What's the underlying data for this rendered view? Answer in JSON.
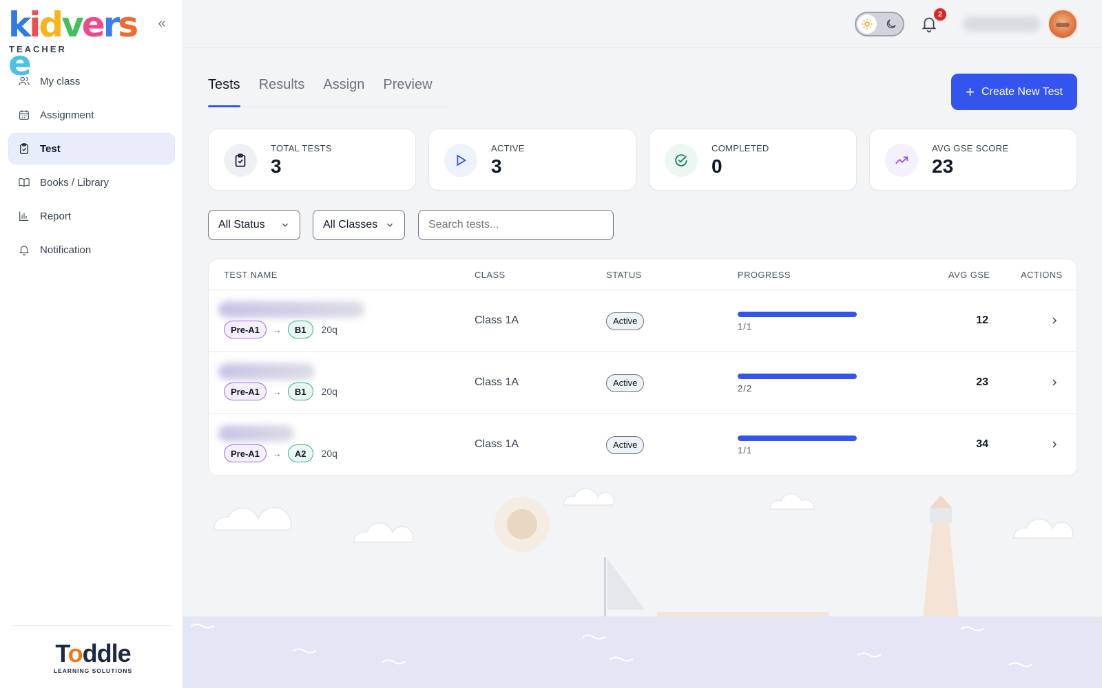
{
  "app": {
    "logo_letters": [
      {
        "ch": "k",
        "color": "#2f7be5"
      },
      {
        "ch": "i",
        "color": "#f04e4e"
      },
      {
        "ch": "d",
        "color": "#f7b51c"
      },
      {
        "ch": "v",
        "color": "#43c05c"
      },
      {
        "ch": "e",
        "color": "#ef4b8a"
      },
      {
        "ch": "r",
        "color": "#3b7ef0"
      },
      {
        "ch": "s",
        "color": "#f26a2e"
      },
      {
        "ch": "e",
        "color": "#4cc3e6"
      }
    ],
    "logo_subtitle": "TEACHER",
    "partner_logo_name": "Toddle",
    "partner_logo_subtitle": "LEARNING SOLUTIONS"
  },
  "sidebar": {
    "items": [
      {
        "label": "My class",
        "icon": "users-icon",
        "active": false
      },
      {
        "label": "Assignment",
        "icon": "calendar-icon",
        "active": false
      },
      {
        "label": "Test",
        "icon": "clipboard-icon",
        "active": true
      },
      {
        "label": "Books / Library",
        "icon": "book-icon",
        "active": false
      },
      {
        "label": "Report",
        "icon": "bar-chart-icon",
        "active": false
      },
      {
        "label": "Notification",
        "icon": "bell-icon",
        "active": false
      }
    ]
  },
  "header": {
    "notification_count": "2"
  },
  "tabs": [
    {
      "label": "Tests",
      "active": true
    },
    {
      "label": "Results",
      "active": false
    },
    {
      "label": "Assign",
      "active": false
    },
    {
      "label": "Preview",
      "active": false
    }
  ],
  "create_button": {
    "label": "Create New Test"
  },
  "stats": [
    {
      "label": "TOTAL TESTS",
      "value": "3",
      "icon": "clipboard-check-icon",
      "bg": "#eef0f3",
      "stroke": "#1f2937"
    },
    {
      "label": "ACTIVE",
      "value": "3",
      "icon": "play-icon",
      "bg": "#eef2fb",
      "stroke": "#3454f0"
    },
    {
      "label": "COMPLETED",
      "value": "0",
      "icon": "check-circle-icon",
      "bg": "#edf7f1",
      "stroke": "#16835b"
    },
    {
      "label": "AVG GSE SCORE",
      "value": "23",
      "icon": "trending-up-icon",
      "bg": "#f5f0fd",
      "stroke": "#9b59e6"
    }
  ],
  "filters": {
    "status": "All Status",
    "classes": "All Classes",
    "search_placeholder": "Search tests..."
  },
  "table": {
    "columns": {
      "name": "TEST NAME",
      "class": "CLASS",
      "status": "STATUS",
      "progress": "PROGRESS",
      "gse": "AVG GSE",
      "actions": "ACTIONS"
    },
    "rows": [
      {
        "from_level": "Pre-A1",
        "to_level": "B1",
        "questions": "20q",
        "class": "Class 1A",
        "status": "Active",
        "progress_text": "1/1",
        "progress": 1.0,
        "gse": "12"
      },
      {
        "from_level": "Pre-A1",
        "to_level": "B1",
        "questions": "20q",
        "class": "Class 1A",
        "status": "Active",
        "progress_text": "2/2",
        "progress": 1.0,
        "gse": "23"
      },
      {
        "from_level": "Pre-A1",
        "to_level": "A2",
        "questions": "20q",
        "class": "Class 1A",
        "status": "Active",
        "progress_text": "1/1",
        "progress": 1.0,
        "gse": "34"
      }
    ]
  },
  "colors": {
    "accent": "#3454f0",
    "active_nav_bg": "#e8ecfb"
  }
}
